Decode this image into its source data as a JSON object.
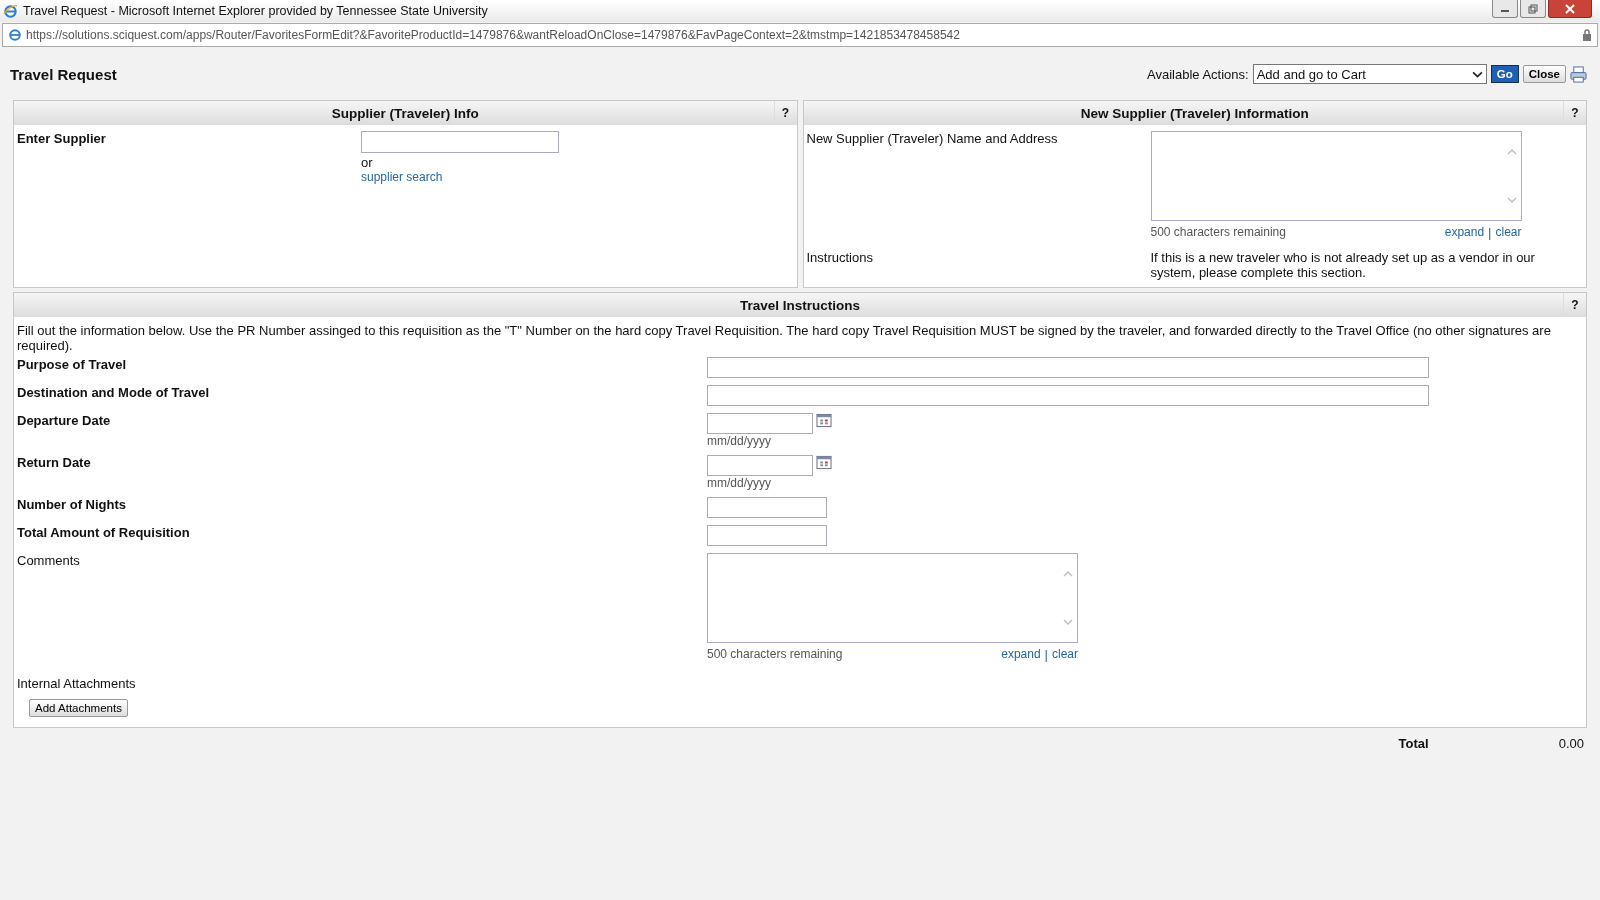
{
  "window": {
    "title": "Travel Request - Microsoft Internet Explorer provided by Tennessee State University"
  },
  "address_bar": {
    "url": "https://solutions.sciquest.com/apps/Router/FavoritesFormEdit?&FavoriteProductId=1479876&wantReloadOnClose=1479876&FavPageContext=2&tmstmp=1421853478458542"
  },
  "page": {
    "title": "Travel Request"
  },
  "actions": {
    "label": "Available Actions:",
    "select_value": "Add and go to Cart",
    "go": "Go",
    "close": "Close"
  },
  "supplier_section": {
    "title": "Supplier (Traveler) Info",
    "help": "?",
    "label": "Enter Supplier",
    "or": "or",
    "link": "supplier search"
  },
  "new_supplier": {
    "title": "New Supplier (Traveler) Information",
    "help": "?",
    "name_label": "New Supplier (Traveler) Name and Address",
    "chars": "500 characters remaining",
    "expand": "expand",
    "separator": "|",
    "clear": "clear",
    "instructions_label": "Instructions",
    "instructions_text": "If this is a new traveler who is not already set up as a vendor in our system, please complete this section."
  },
  "travel": {
    "title": "Travel Instructions",
    "help": "?",
    "intro": "Fill out the information below. Use the PR Number assinged to this requisition as the \"T\" Number on the hard copy Travel Requisition. The hard copy Travel Requisition MUST be signed by the traveler, and forwarded directly to the Travel Office (no other signatures are required).",
    "fields": [
      {
        "kind": "wide",
        "label": "Purpose of Travel",
        "required": true
      },
      {
        "kind": "wide",
        "label": "Destination and Mode of Travel",
        "required": true
      },
      {
        "kind": "date",
        "label": "Departure Date",
        "required": true,
        "hint": "mm/dd/yyyy"
      },
      {
        "kind": "date",
        "label": "Return Date",
        "required": true,
        "hint": "mm/dd/yyyy"
      },
      {
        "kind": "short",
        "label": "Number of Nights",
        "required": true
      },
      {
        "kind": "short",
        "label": "Total Amount of Requisition",
        "required": true
      },
      {
        "kind": "textarea",
        "label": "Comments",
        "required": false,
        "chars": "500 characters remaining",
        "expand": "expand",
        "separator": "|",
        "clear": "clear"
      }
    ],
    "attachments_label": "Internal Attachments",
    "add_button": "Add Attachments"
  },
  "total": {
    "label": "Total",
    "value": "0.00"
  }
}
